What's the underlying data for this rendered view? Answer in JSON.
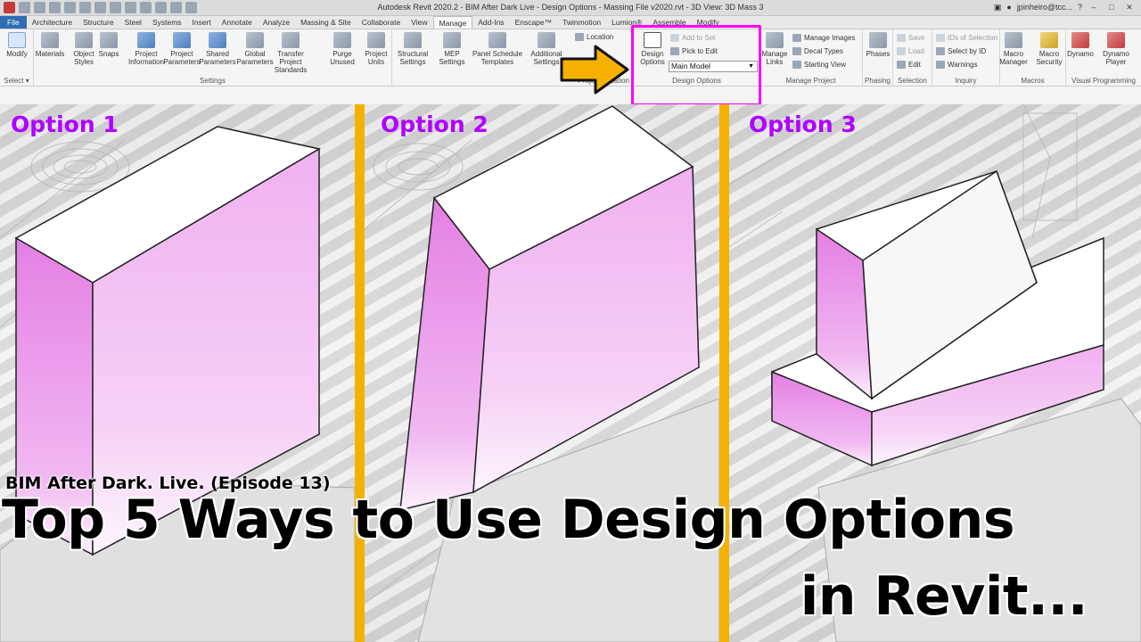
{
  "window": {
    "title": "Autodesk Revit 2020.2 - BIM After Dark Live - Design Options - Massing File v2020.rvt - 3D View: 3D Mass 3",
    "user": "jpinheiro@tcc..."
  },
  "tabs": [
    "File",
    "Architecture",
    "Structure",
    "Steel",
    "Systems",
    "Insert",
    "Annotate",
    "Analyze",
    "Massing & Site",
    "Collaborate",
    "View",
    "Manage",
    "Add-Ins",
    "Enscape™",
    "Twinmotion",
    "Lumion®",
    "Assemble",
    "Modify"
  ],
  "active_tab": "Manage",
  "ribbon": {
    "select": {
      "modify": "Modify",
      "label": "Select ▾"
    },
    "settings": {
      "tools": [
        "Materials",
        "Object Styles",
        "Snaps",
        "Project Information",
        "Project Parameters",
        "Shared Parameters",
        "Global Parameters",
        "Transfer Project Standards",
        "Purge Unused",
        "Project Units",
        "Structural Settings",
        "MEP Settings",
        "Panel Schedule Templates",
        "Additional Settings"
      ],
      "label": "Settings"
    },
    "project_location": {
      "location": "Location",
      "label": "Project Location"
    },
    "design_options": {
      "main_button": "Design Options",
      "add_to_set": "Add to Set",
      "pick_to_edit": "Pick to Edit",
      "current_option": "Main Model",
      "label": "Design Options"
    },
    "manage_project": {
      "manage_links": "Manage Links",
      "manage_images": "Manage Images",
      "decal_types": "Decal  Types",
      "starting_view": "Starting  View",
      "label": "Manage Project"
    },
    "phasing": {
      "phases": "Phases",
      "label": "Phasing"
    },
    "selection": {
      "save": "Save",
      "load": "Load",
      "edit": "Edit",
      "label": "Selection"
    },
    "inquiry": {
      "ids": "IDs of  Selection",
      "select_by_id": "Select  by ID",
      "warnings": "Warnings",
      "label": "Inquiry"
    },
    "macros": {
      "manager": "Macro Manager",
      "security": "Macro Security",
      "label": "Macros"
    },
    "visual_programming": {
      "dynamo": "Dynamo",
      "player": "Dynamo Player",
      "label": "Visual Programming"
    }
  },
  "options": [
    "Option 1",
    "Option 2",
    "Option 3"
  ],
  "overlay": {
    "subtitle": "BIM After Dark. Live. (Episode 13)",
    "title_line1": "Top 5 Ways to Use Design Options",
    "title_line2": "in Revit..."
  },
  "colors": {
    "highlight": "#ff00ff",
    "option_label": "#b000ff",
    "divider": "#f6b100",
    "mass_face": "#e680e6",
    "arrow": "#f6b100"
  }
}
